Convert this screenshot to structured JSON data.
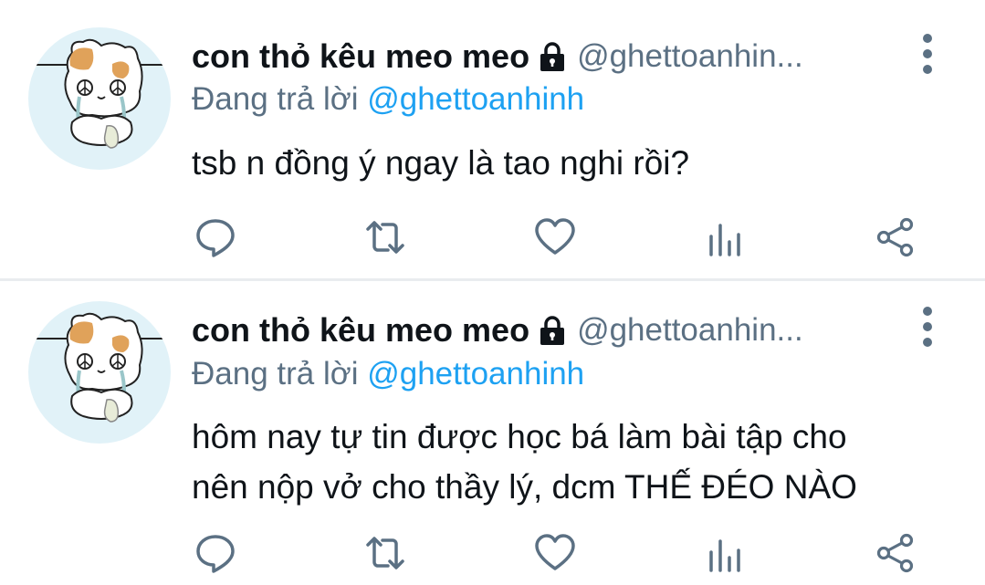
{
  "tweets": [
    {
      "display_name": "con thỏ kêu meo meo",
      "handle": "@ghettoanhin...",
      "replying_prefix": "Đang trả lời",
      "replying_to": "@ghettoanhinh",
      "text_lines": [
        "tsb n đồng ý ngay là tao nghi rồi?"
      ],
      "icons": {
        "lock": "lock-icon",
        "more": "more-vertical-icon",
        "reply": "reply-icon",
        "retweet": "retweet-icon",
        "like": "heart-icon",
        "analytics": "analytics-icon",
        "share": "share-icon"
      }
    },
    {
      "display_name": "con thỏ kêu meo meo",
      "handle": "@ghettoanhin...",
      "replying_prefix": "Đang trả lời",
      "replying_to": "@ghettoanhinh",
      "text_lines": [
        "hôm nay tự tin được học bá làm bài tập cho",
        "nên nộp vở cho thầy lý, dcm THẾ ĐÉO NÀO"
      ],
      "icons": {
        "lock": "lock-icon",
        "more": "more-vertical-icon",
        "reply": "reply-icon",
        "retweet": "retweet-icon",
        "like": "heart-icon",
        "analytics": "analytics-icon",
        "share": "share-icon"
      }
    }
  ],
  "colors": {
    "text": "#0f1419",
    "secondary": "#5b7083",
    "link": "#1da1f2",
    "icon": "#5b7083",
    "avatar_bg": "#e1f2f8"
  }
}
